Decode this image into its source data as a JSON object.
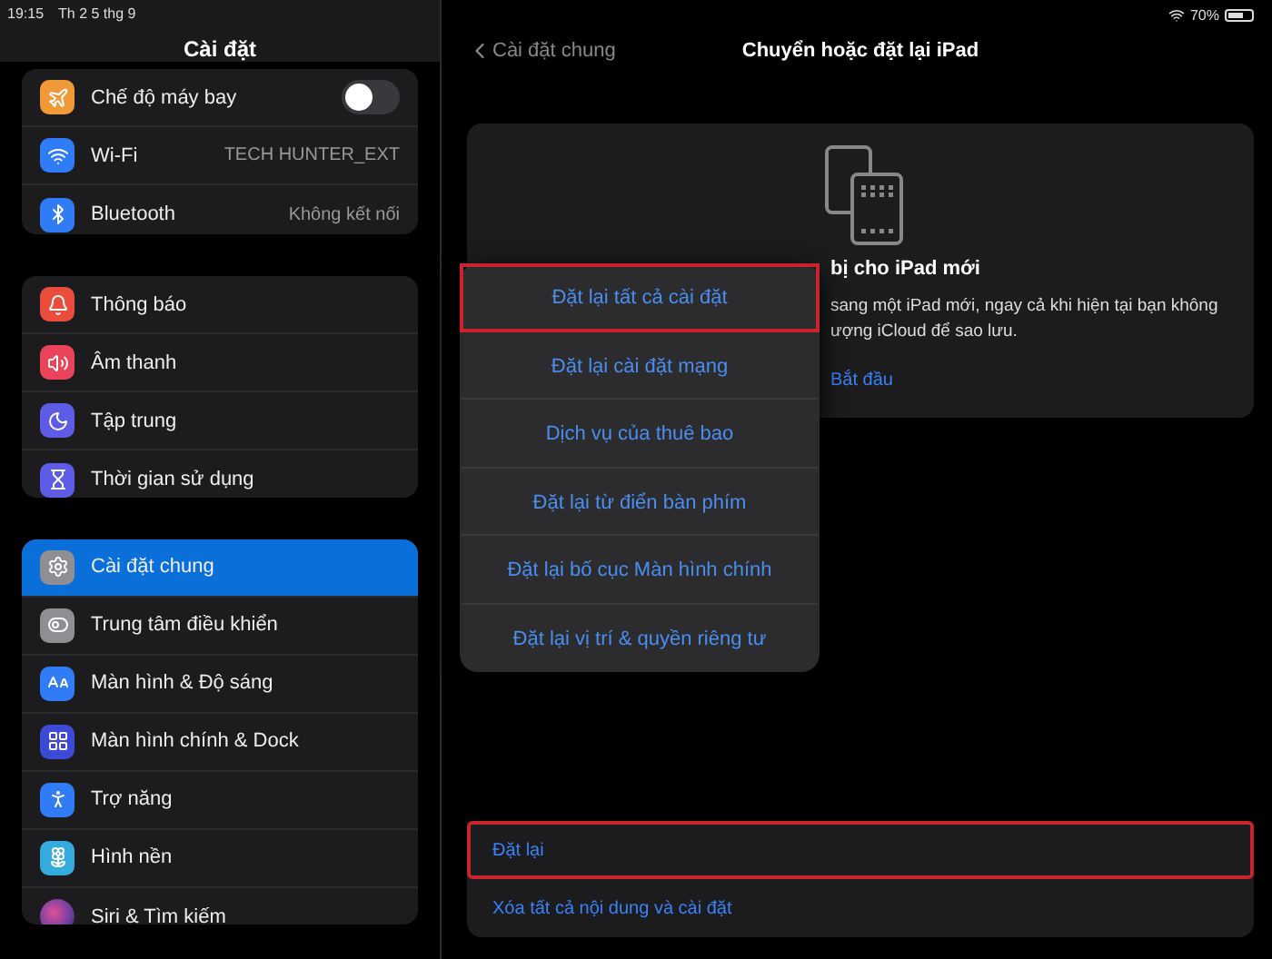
{
  "status_bar": {
    "time": "19:15",
    "date": "Th 2 5 thg 9",
    "battery": "70%"
  },
  "sidebar": {
    "title": "Cài đặt",
    "groups": [
      {
        "items": [
          {
            "label": "Chế độ máy bay",
            "kind": "toggle",
            "on": false,
            "selected": false
          },
          {
            "label": "Wi-Fi",
            "kind": "value",
            "value": "TECH HUNTER_EXT",
            "selected": false
          },
          {
            "label": "Bluetooth",
            "kind": "value",
            "value": "Không kết nối",
            "selected": false
          }
        ]
      },
      {
        "items": [
          {
            "label": "Thông báo",
            "kind": "link",
            "selected": false
          },
          {
            "label": "Âm thanh",
            "kind": "link",
            "selected": false
          },
          {
            "label": "Tập trung",
            "kind": "link",
            "selected": false
          },
          {
            "label": "Thời gian sử dụng",
            "kind": "link",
            "selected": false
          }
        ]
      },
      {
        "items": [
          {
            "label": "Cài đặt chung",
            "kind": "link",
            "selected": true
          },
          {
            "label": "Trung tâm điều khiển",
            "kind": "link",
            "selected": false
          },
          {
            "label": "Màn hình & Độ sáng",
            "kind": "link",
            "selected": false
          },
          {
            "label": "Màn hình chính & Dock",
            "kind": "link",
            "selected": false
          },
          {
            "label": "Trợ năng",
            "kind": "link",
            "selected": false
          },
          {
            "label": "Hình nền",
            "kind": "link",
            "selected": false
          },
          {
            "label": "Siri & Tìm kiếm",
            "kind": "link",
            "selected": false
          }
        ]
      }
    ]
  },
  "detail": {
    "back": "Cài đặt chung",
    "title": "Chuyển hoặc đặt lại iPad",
    "card": {
      "title": "bị cho iPad mới",
      "lines": [
        "sang một iPad mới, ngay cả khi hiện tại bạn không",
        "ượng iCloud để sao lưu."
      ],
      "action": "Bắt đầu"
    },
    "reset_menu": [
      {
        "label": "Đặt lại tất cả cài đặt",
        "highlighted": true
      },
      {
        "label": "Đặt lại cài đặt mạng",
        "highlighted": false
      },
      {
        "label": "Dịch vụ của thuê bao",
        "highlighted": false
      },
      {
        "label": "Đặt lại từ điển bàn phím",
        "highlighted": false
      },
      {
        "label": "Đặt lại bố cục Màn hình chính",
        "highlighted": false
      },
      {
        "label": "Đặt lại vị trí & quyền riêng tư",
        "highlighted": false
      }
    ],
    "actions": [
      {
        "label": "Đặt lại",
        "highlighted": true
      },
      {
        "label": "Xóa tất cả nội dung và cài đặt",
        "highlighted": false
      }
    ]
  }
}
